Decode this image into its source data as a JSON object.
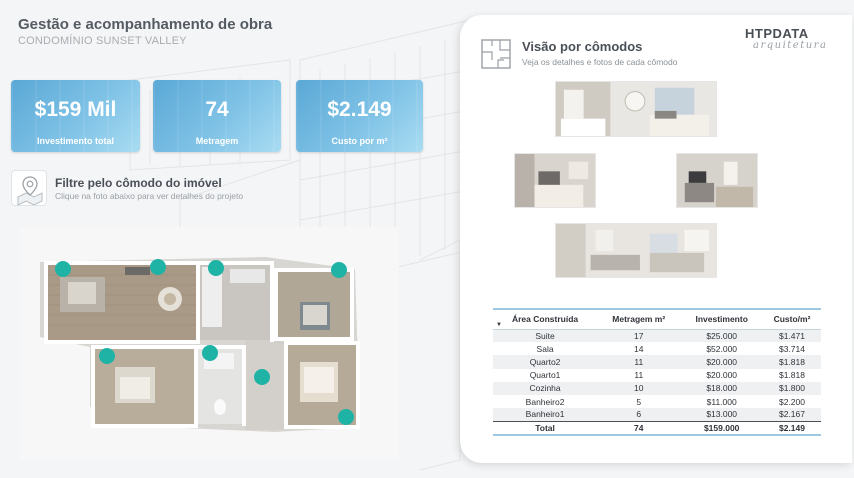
{
  "header": {
    "title": "Gestão e acompanhamento de obra",
    "subtitle": "CONDOMÍNIO SUNSET VALLEY"
  },
  "kpis": [
    {
      "value": "$159 Mil",
      "label": "Investimento total"
    },
    {
      "value": "74",
      "label": "Metragem"
    },
    {
      "value": "$2.149",
      "label": "Custo por m²"
    }
  ],
  "filter": {
    "title": "Filtre pelo cômodo do imóvel",
    "subtitle": "Clique na foto abaixo para ver detalhes do projeto",
    "icon": "map-pin-icon"
  },
  "panel": {
    "title": "Visão por cômodos",
    "subtitle": "Veja os detalhes e fotos de cada cômodo",
    "brand": "HTPDATA",
    "brand_tagline": "arquitetura",
    "icon": "floor-plan-icon"
  },
  "colors": {
    "accent": "#5aa8d6",
    "marker": "#1fb3a6",
    "table_border": "#9cc8e0"
  },
  "table": {
    "columns": [
      "Área Construída",
      "Metragem m²",
      "Investimento",
      "Custo/m²"
    ],
    "rows": [
      [
        "Suite",
        "17",
        "$25.000",
        "$1.471"
      ],
      [
        "Sala",
        "14",
        "$52.000",
        "$3.714"
      ],
      [
        "Quarto2",
        "11",
        "$20.000",
        "$1.818"
      ],
      [
        "Quarto1",
        "11",
        "$20.000",
        "$1.818"
      ],
      [
        "Cozinha",
        "10",
        "$18.000",
        "$1.800"
      ],
      [
        "Banheiro2",
        "5",
        "$11.000",
        "$2.200"
      ],
      [
        "Banheiro1",
        "6",
        "$13.000",
        "$2.167"
      ]
    ],
    "total": [
      "Total",
      "74",
      "$159.000",
      "$2.149"
    ]
  }
}
